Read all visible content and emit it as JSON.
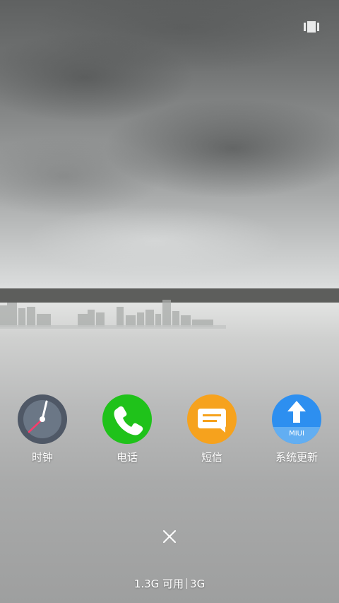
{
  "apps": [
    {
      "name": "时钟",
      "icon": "clock-icon",
      "color": "#4f5866"
    },
    {
      "name": "电话",
      "icon": "phone-icon",
      "color": "#1fc21a"
    },
    {
      "name": "短信",
      "icon": "message-icon",
      "color": "#f6a21d"
    },
    {
      "name": "系统更新",
      "icon": "update-arrow-icon",
      "color": "#2d8ff0",
      "badge": "MIUI"
    }
  ],
  "footer": {
    "available_memory": "1.3G 可用",
    "total_memory": "3G"
  },
  "controls": {
    "recents_icon": "recents-icon",
    "close_icon": "close-icon"
  }
}
